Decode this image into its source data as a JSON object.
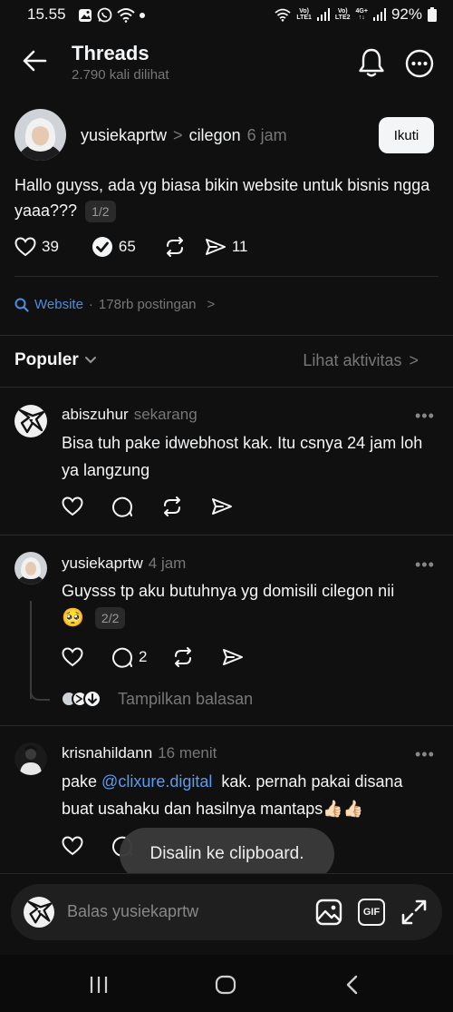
{
  "status_bar": {
    "time": "15.55",
    "net1_top": "Vo)",
    "net1_bottom": "LTE1",
    "net2_top": "Vo)",
    "net2_bottom": "LTE2",
    "net3_top": "4G+",
    "net3_bottom": "↑↓",
    "battery": "92%"
  },
  "header": {
    "title": "Threads",
    "subtitle": "2.790 kali dilihat"
  },
  "post": {
    "username": "yusiekaprtw",
    "separator": ">",
    "location": "cilegon",
    "time": "6 jam",
    "follow_label": "Ikuti",
    "text": "Hallo guyss, ada yg biasa bikin website untuk bisnis ngga yaaa???",
    "pager": "1/2",
    "likes": "39",
    "reposts": "65",
    "shares": "11"
  },
  "topic": {
    "name": "Website",
    "sep": "·",
    "count": "178rb postingan",
    "chevron": ">"
  },
  "replies_header": {
    "sort_label": "Populer",
    "activity_label": "Lihat aktivitas",
    "activity_chevron": ">"
  },
  "comments": [
    {
      "username": "abiszuhur",
      "time": "sekarang",
      "text": "Bisa tuh pake idwebhost kak. Itu csnya 24 jam loh ya langzung"
    },
    {
      "username": "yusiekaprtw",
      "time": "4 jam",
      "text": "Guysss tp aku butuhnya yg domisili cilegon nii",
      "emoji": "🥺",
      "pager": "2/2",
      "reply_count": "2",
      "show_replies": "Tampilkan balasan"
    },
    {
      "username": "krisnahildann",
      "time": "16 menit",
      "text_before": "pake ",
      "mention": "@clixure.digital",
      "text_after": "  kak. pernah pakai disana buat usahaku dan hasilnya mantaps👍🏻👍🏻"
    }
  ],
  "toast": "Disalin ke clipboard.",
  "composer": {
    "placeholder": "Balas yusiekaprtw",
    "gif_label": "GIF"
  },
  "more_dots": "•••",
  "icons": [
    "back-arrow-icon",
    "bell-icon",
    "more-icon",
    "heart-icon",
    "repost-check-icon",
    "repost-icon",
    "share-icon",
    "comment-icon",
    "search-icon",
    "chevron-down-icon",
    "image-icon",
    "gif-icon",
    "expand-icon",
    "recents-icon",
    "home-icon",
    "back-icon"
  ]
}
